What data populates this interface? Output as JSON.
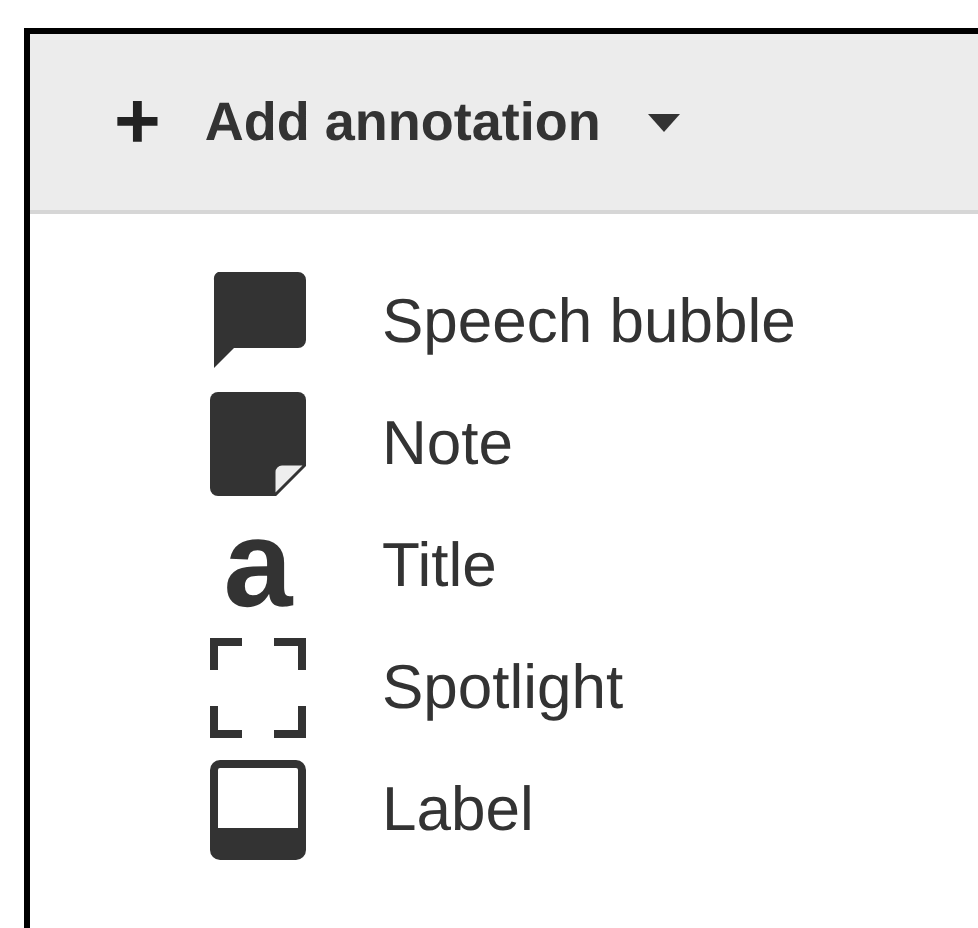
{
  "menu": {
    "button": {
      "icon": "+",
      "label": "Add annotation"
    },
    "items": [
      {
        "kind": "speech",
        "label": "Speech bubble"
      },
      {
        "kind": "note",
        "label": "Note"
      },
      {
        "kind": "title",
        "glyph": "a",
        "label": "Title"
      },
      {
        "kind": "spotlight",
        "label": "Spotlight"
      },
      {
        "kind": "label",
        "label": "Label"
      }
    ]
  }
}
